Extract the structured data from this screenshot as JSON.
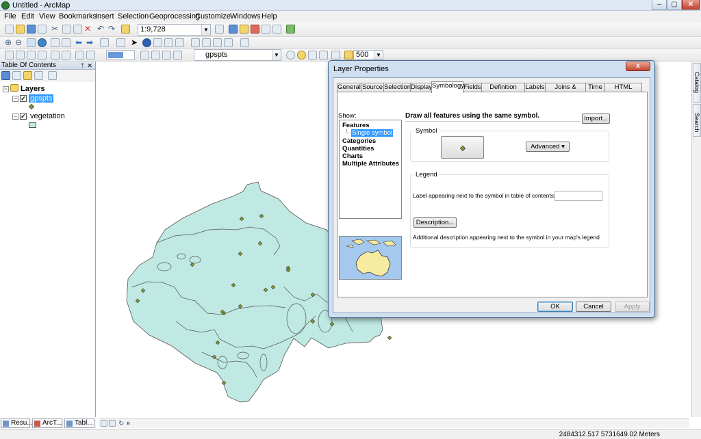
{
  "window": {
    "title": "Untitled - ArcMap",
    "controls": [
      "–",
      "▢",
      "✕"
    ]
  },
  "menu": [
    "File",
    "Edit",
    "View",
    "Bookmarks",
    "Insert",
    "Selection",
    "Geoprocessing",
    "Customize",
    "Windows",
    "Help"
  ],
  "toolbar": {
    "scale_value": "1:9,728",
    "layer_combo_value": "gpspts",
    "buffer_value": "500"
  },
  "toc": {
    "header": "Table Of Contents",
    "pin": "ᛘ",
    "close": "✕",
    "root": "Layers",
    "layers": [
      {
        "name": "gpspts",
        "checked": true,
        "selected": true
      },
      {
        "name": "vegetation",
        "checked": true,
        "selected": false
      }
    ]
  },
  "bottom_tabs": [
    "Resu...",
    "ArcT...",
    "Tabl..."
  ],
  "side_tabs": [
    "Catalog",
    "Search"
  ],
  "status": {
    "coordinates": "2484312.517  5731649.02 Meters"
  },
  "dialog": {
    "title": "Layer Properties",
    "close": "x",
    "tabs": [
      "General",
      "Source",
      "Selection",
      "Display",
      "Symbology",
      "Fields",
      "Definition Query",
      "Labels",
      "Joins & Relates",
      "Time",
      "HTML Popup"
    ],
    "active_tab": "Symbology",
    "show_label": "Show:",
    "show_tree": [
      {
        "label": "Features",
        "level": 0
      },
      {
        "label": "Single symbol",
        "level": 1,
        "selected": true
      },
      {
        "label": "Categories",
        "level": 0
      },
      {
        "label": "Quantities",
        "level": 0
      },
      {
        "label": "Charts",
        "level": 0
      },
      {
        "label": "Multiple Attributes",
        "level": 0
      }
    ],
    "heading": "Draw all features using the same symbol.",
    "import_button": "Import...",
    "symbol_group": "Symbol",
    "advanced_button": "Advanced",
    "advanced_arrow": "▾",
    "legend_group": "Legend",
    "label_prompt": "Label appearing next to the symbol in table of contents:",
    "label_value": "",
    "description_button": "Description...",
    "description_hint": "Additional description appearing next to the symbol in your map's legend",
    "ok_button": "OK",
    "cancel_button": "Cancel",
    "apply_button": "Apply"
  },
  "colors": {
    "vegetation_fill": "#bfe9e2",
    "vegetation_stroke": "#555555",
    "point_fill": "#8a9a2a",
    "selection_blue": "#3399ff"
  }
}
